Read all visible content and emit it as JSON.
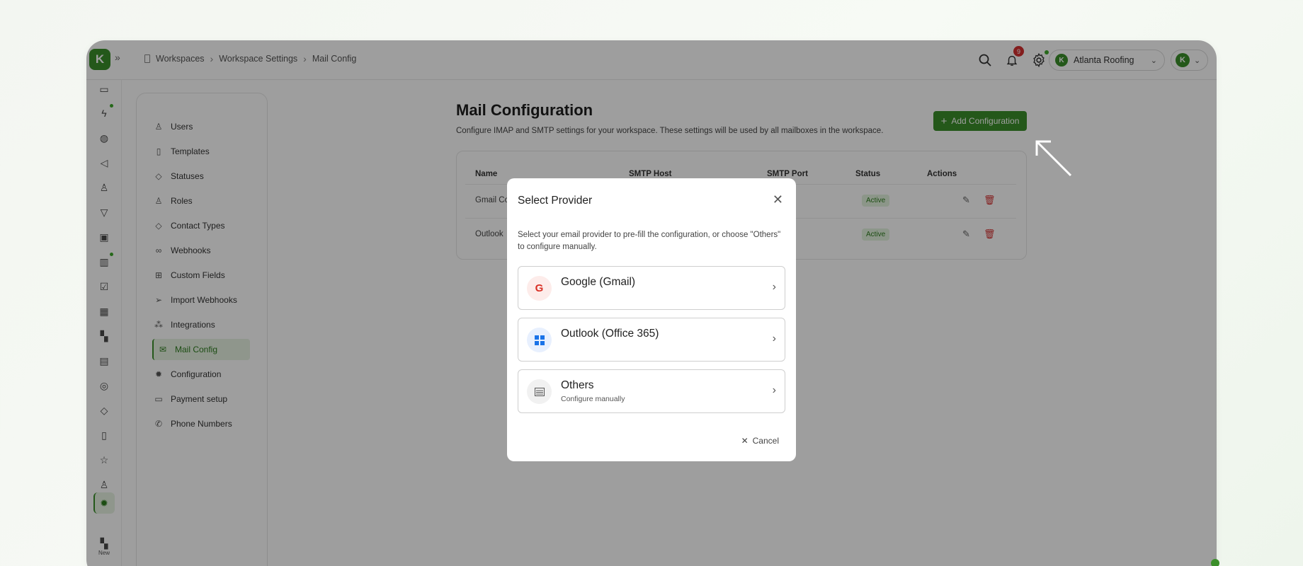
{
  "app": {
    "logo_letter": "K",
    "expand_icon": "double-chevron-right-icon"
  },
  "breadcrumb": {
    "items": [
      "Workspaces",
      "Workspace Settings",
      "Mail Config"
    ]
  },
  "topbar": {
    "notification_count": "9",
    "workspace_name": "Atlanta Roofing",
    "workspace_logo": "K",
    "user_avatar": "K"
  },
  "rail": {
    "new_label": "New"
  },
  "settings_nav": {
    "items": [
      {
        "label": "Users",
        "icon": "user-icon"
      },
      {
        "label": "Templates",
        "icon": "file-icon"
      },
      {
        "label": "Statuses",
        "icon": "tags-icon"
      },
      {
        "label": "Roles",
        "icon": "users-icon"
      },
      {
        "label": "Contact Types",
        "icon": "tag-icon"
      },
      {
        "label": "Webhooks",
        "icon": "webhook-icon"
      },
      {
        "label": "Custom Fields",
        "icon": "grid-icon"
      },
      {
        "label": "Import Webhooks",
        "icon": "send-icon"
      },
      {
        "label": "Integrations",
        "icon": "integrations-icon"
      },
      {
        "label": "Mail Config",
        "icon": "mail-icon"
      },
      {
        "label": "Configuration",
        "icon": "gear-icon"
      },
      {
        "label": "Payment setup",
        "icon": "card-icon"
      },
      {
        "label": "Phone Numbers",
        "icon": "phone-icon"
      }
    ],
    "active": "Mail Config"
  },
  "main": {
    "title": "Mail Configuration",
    "subtitle": "Configure IMAP and SMTP settings for your workspace. These settings will be used by all mailboxes in the workspace.",
    "add_button": "Add Configuration",
    "table": {
      "headers": [
        "Name",
        "SMTP Host",
        "SMTP Port",
        "Status",
        "Actions"
      ],
      "rows": [
        {
          "name": "Gmail Co",
          "status": "Active"
        },
        {
          "name": "Outlook",
          "status": "Active"
        }
      ]
    }
  },
  "modal": {
    "title": "Select Provider",
    "description": "Select your email provider to pre-fill the configuration, or choose \"Others\" to configure manually.",
    "providers": [
      {
        "name": "Google (Gmail)",
        "sub": "",
        "icon": "google-icon",
        "icon_letter": "G",
        "icon_color": "#d93025",
        "icon_bg": "#fdecea"
      },
      {
        "name": "Outlook (Office 365)",
        "sub": "",
        "icon": "windows-icon",
        "icon_color": "#1a73e8",
        "icon_bg": "#e8f0fe"
      },
      {
        "name": "Others",
        "sub": "Configure manually",
        "icon": "server-icon",
        "icon_color": "#555555",
        "icon_bg": "#f1f1f1"
      }
    ],
    "cancel": "Cancel"
  },
  "colors": {
    "brand": "#3b8f2a",
    "danger": "#d32f2f",
    "overlay": "rgba(0,0,0,0.38)"
  }
}
